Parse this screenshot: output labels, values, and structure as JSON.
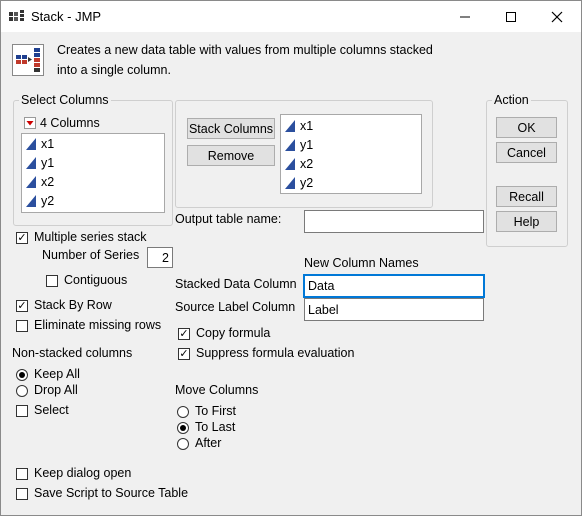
{
  "window": {
    "title": "Stack - JMP",
    "description": "Creates a new data table with values from multiple columns stacked into a single column.",
    "description_line1": "Creates a new data table with values from multiple columns stacked",
    "description_line2": "into a single column."
  },
  "select_columns": {
    "label": "Select Columns",
    "count_label": "4 Columns",
    "items": [
      "x1",
      "y1",
      "x2",
      "y2"
    ]
  },
  "stack": {
    "stack_columns_button": "Stack Columns",
    "remove_button": "Remove",
    "items": [
      "x1",
      "y1",
      "x2",
      "y2"
    ]
  },
  "action": {
    "label": "Action",
    "ok": "OK",
    "cancel": "Cancel",
    "recall": "Recall",
    "help": "Help"
  },
  "output": {
    "label": "Output table name:",
    "value": ""
  },
  "options": {
    "multiple_series_stack": {
      "label": "Multiple series stack",
      "checked": true
    },
    "number_of_series_label": "Number of Series",
    "number_of_series_value": "2",
    "contiguous": {
      "label": "Contiguous",
      "checked": false
    },
    "stack_by_row": {
      "label": "Stack By Row",
      "checked": true
    },
    "eliminate_missing_rows": {
      "label": "Eliminate missing rows",
      "checked": false
    }
  },
  "new_column_names": {
    "header": "New Column Names",
    "stacked_label": "Stacked Data Column",
    "stacked_value": "Data",
    "source_label": "Source Label Column",
    "source_value": "Label"
  },
  "formula": {
    "copy_formula": {
      "label": "Copy formula",
      "checked": true
    },
    "suppress_formula": {
      "label": "Suppress formula evaluation",
      "checked": true
    }
  },
  "non_stacked": {
    "header": "Non-stacked columns",
    "keep_all": "Keep All",
    "drop_all": "Drop All",
    "select": "Select",
    "selected": "Keep All"
  },
  "move_columns": {
    "header": "Move Columns",
    "to_first": "To First",
    "to_last": "To Last",
    "after": "After",
    "selected": "To Last"
  },
  "footer": {
    "keep_dialog_open": {
      "label": "Keep dialog open",
      "checked": false
    },
    "save_script": {
      "label": "Save Script to Source Table",
      "checked": false
    }
  },
  "colors": {
    "focus_border": "#0078d7",
    "triangle": "#1f3f8f",
    "red_arrow": "#cc0000"
  }
}
